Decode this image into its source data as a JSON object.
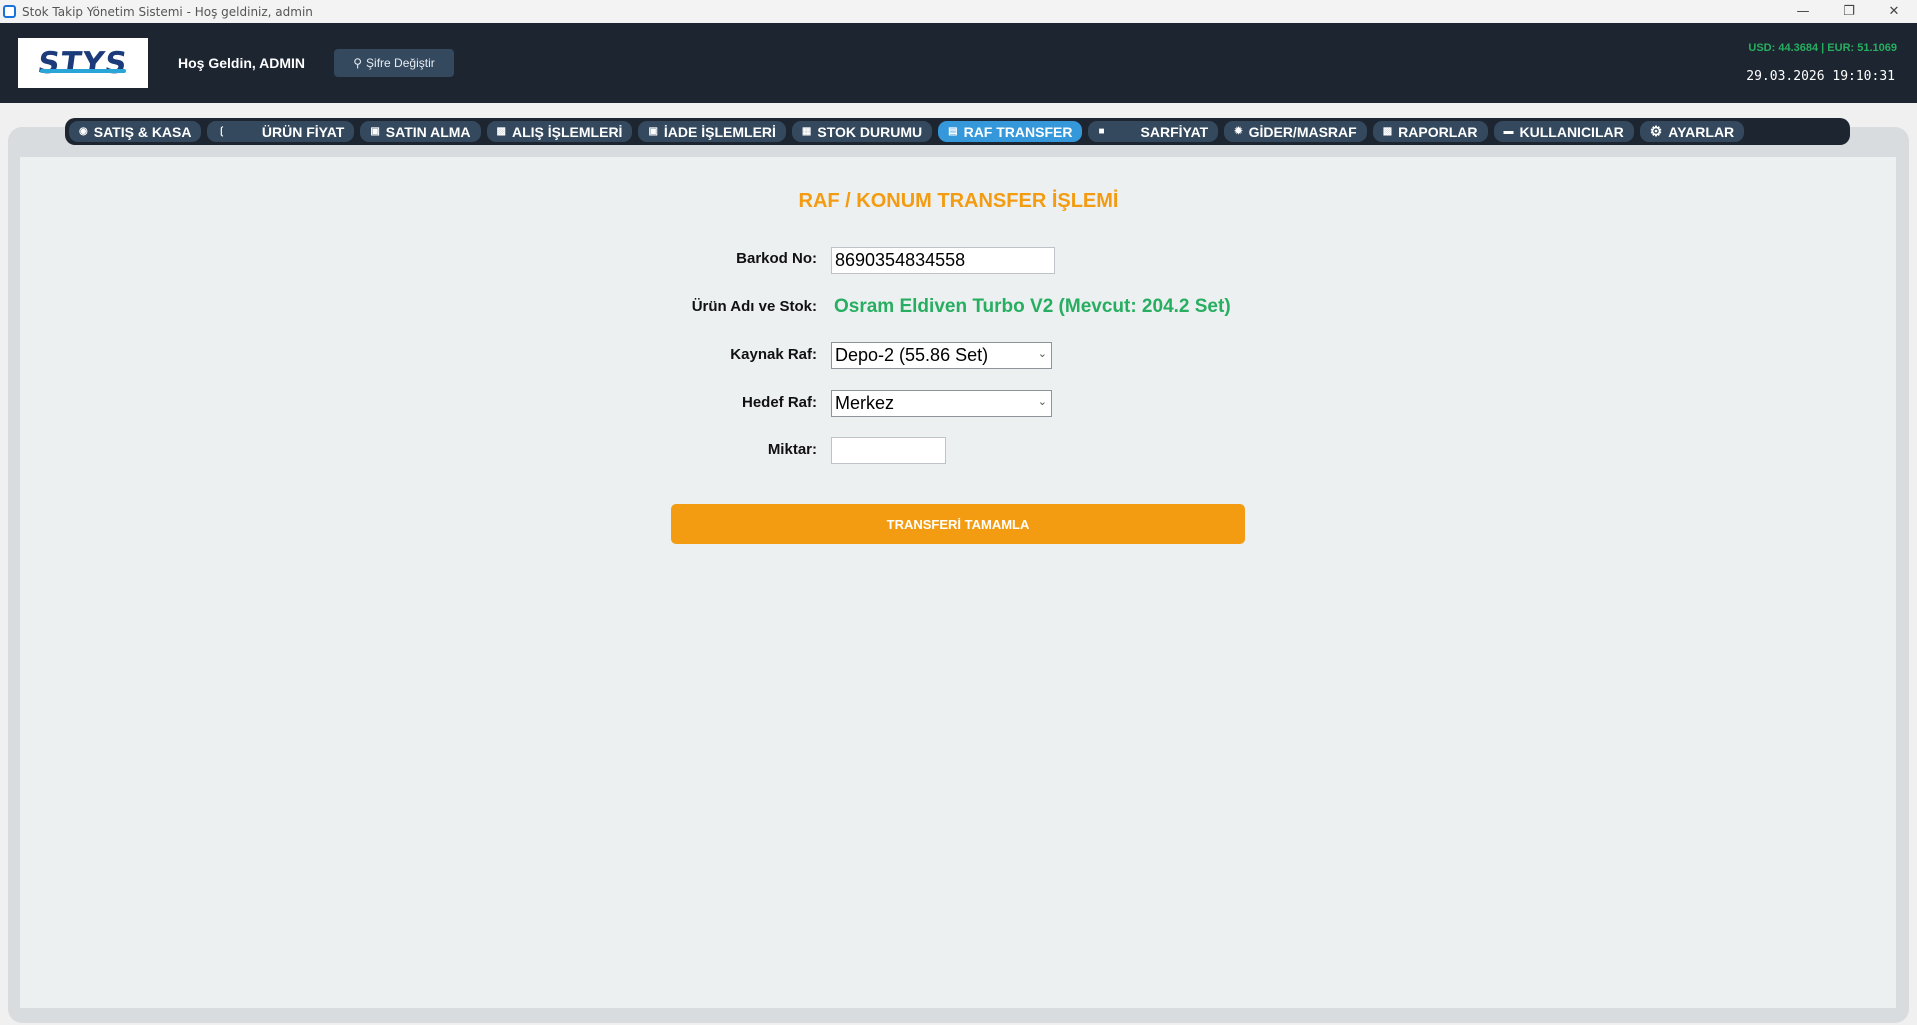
{
  "window": {
    "title": "Stok Takip Yönetim Sistemi - Hoş geldiniz, admin"
  },
  "header": {
    "logo_text": "STYS",
    "welcome": "Hoş Geldin, ADMIN",
    "password_button": "Şifre Değiştir",
    "rates": "USD: 44.3684 | EUR: 51.1069",
    "datetime": "29.03.2026 19:10:31"
  },
  "nav": {
    "tabs": [
      {
        "label": "SATIŞ & KASA",
        "icon": "money-bag-icon"
      },
      {
        "label": "ÜRÜN FİYAT",
        "icon": "tag-icon"
      },
      {
        "label": "SATIN ALMA",
        "icon": "cart-icon"
      },
      {
        "label": "ALIŞ İŞLEMLERİ",
        "icon": "truck-icon"
      },
      {
        "label": "İADE İŞLEMLERİ",
        "icon": "return-box-icon"
      },
      {
        "label": "STOK DURUMU",
        "icon": "clipboard-icon"
      },
      {
        "label": "RAF TRANSFER",
        "icon": "shelf-icon"
      },
      {
        "label": "SARFİYAT",
        "icon": "trash-icon"
      },
      {
        "label": "GİDER/MASRAF",
        "icon": "expense-icon"
      },
      {
        "label": "RAPORLAR",
        "icon": "report-icon"
      },
      {
        "label": "KULLANICILAR",
        "icon": "users-icon"
      },
      {
        "label": "AYARLAR",
        "icon": "gear-icon"
      }
    ],
    "active": "RAF TRANSFER",
    "active_color": "#3498db"
  },
  "form": {
    "title": "RAF / KONUM TRANSFER İŞLEMİ",
    "barcode_label": "Barkod No:",
    "barcode_value": "8690354834558",
    "product_label": "Ürün Adı ve Stok:",
    "product_value": "Osram Eldiven Turbo V2 (Mevcut: 204.2 Set)",
    "source_label": "Kaynak Raf:",
    "source_value": "Depo-2 (55.86 Set)",
    "target_label": "Hedef Raf:",
    "target_value": "Merkez",
    "quantity_label": "Miktar:",
    "quantity_value": "",
    "submit_label": "TRANSFERİ TAMAMLA"
  },
  "colors": {
    "accent": "#f39c12",
    "success": "#27ae60",
    "header_bg": "#1c2530"
  }
}
